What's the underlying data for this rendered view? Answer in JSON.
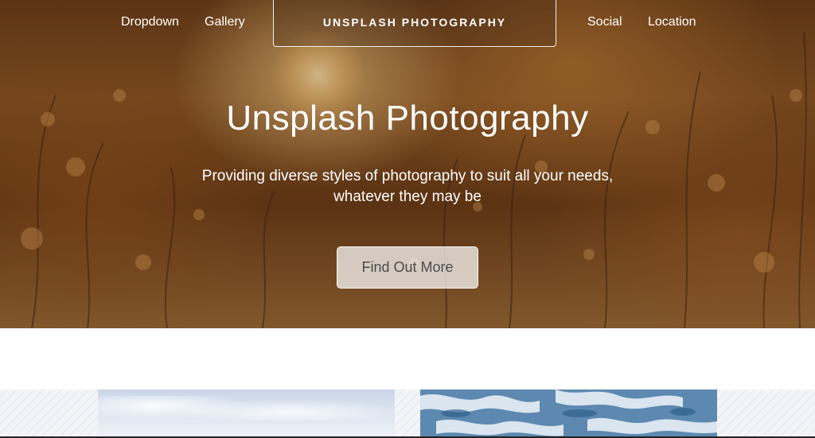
{
  "nav": {
    "left_links": [
      "Dropdown",
      "Gallery"
    ],
    "brand": "UNSPLASH PHOTOGRAPHY",
    "right_links": [
      "Social",
      "Location"
    ]
  },
  "hero": {
    "title": "Unsplash Photography",
    "subtitle_line1": "Providing diverse styles of photography to suit all your needs,",
    "subtitle_line2": "whatever they may be",
    "cta_label": "Find Out More",
    "background_image": "golden sunset field photo"
  },
  "gallery": {
    "thumbnails": [
      "sky photo",
      "water photo"
    ]
  },
  "colors": {
    "hero_tint": "#7a4a20",
    "text": "#ffffff",
    "cta_text": "#4a4a4a",
    "water": "#5d89b0"
  }
}
